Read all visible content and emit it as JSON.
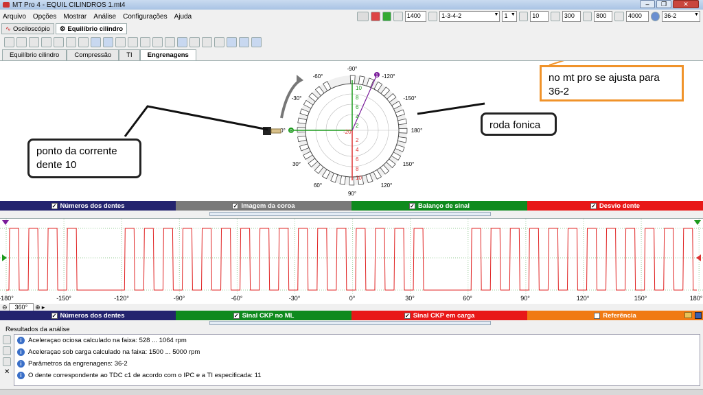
{
  "window": {
    "title": "MT Pro 4 - EQUIL CILINDROS 1.mt4"
  },
  "menu": [
    "Arquivo",
    "Opções",
    "Mostrar",
    "Análise",
    "Configurações",
    "Ajuda"
  ],
  "right_toolbar": {
    "rpm_value": "1400",
    "firing_order": "1-3-4-2",
    "cylinder": "1",
    "angle": "10",
    "field_300": "300",
    "field_800": "800",
    "field_4000": "4000",
    "wheel_type": "36-2"
  },
  "top_tabs": [
    "Osciloscópio",
    "Equilíbrio cilindro"
  ],
  "sub_tabs": [
    "Equilíbrio cilindro",
    "Compressão",
    "TI",
    "Engrenagens"
  ],
  "gear": {
    "degree_labels_top": [
      "-90°",
      "-60°",
      "-120°",
      "-30°",
      "-150°",
      "0°",
      "180°",
      "30°",
      "150°",
      "60°",
      "120°",
      "90°"
    ],
    "scale_labels": [
      "10",
      "8",
      "6",
      "4",
      "2",
      "-20",
      "2",
      "4",
      "6",
      "8",
      "10"
    ],
    "marker_zero": "0",
    "marker_one": "1"
  },
  "callouts": {
    "mt_pro": "no mt pro se ajusta para 36-2",
    "roda": "roda fonica",
    "ponto": "ponto da corrente dente 10"
  },
  "status_bar_1": [
    {
      "label": "Números dos dentes",
      "color": "#23236e"
    },
    {
      "label": "Imagem da coroa",
      "color": "#7a7a7a"
    },
    {
      "label": "Balanço de sinal",
      "color": "#0f8a1e"
    },
    {
      "label": "Desvio dente",
      "color": "#e81818"
    }
  ],
  "wave_axis": [
    "-180°",
    "-150°",
    "-120°",
    "-90°",
    "-60°",
    "-30°",
    "0°",
    "30°",
    "60°",
    "90°",
    "120°",
    "150°",
    "180°"
  ],
  "zoom": {
    "label": "360°"
  },
  "status_bar_2": [
    {
      "label": "Números dos dentes",
      "color": "#23236e"
    },
    {
      "label": "Sinal CKP no ML",
      "color": "#0f8a1e"
    },
    {
      "label": "Sinal CKP em carga",
      "color": "#e81818"
    },
    {
      "label": "Referência",
      "color": "#f07a14"
    }
  ],
  "results": {
    "header": "Resultados da análise",
    "lines": [
      "Aceleraçao ociosa calculado na faixa: 528 ... 1064 rpm",
      "Aceleraçao sob carga calculado na faixa: 1500 ... 5000 rpm",
      "Parâmetros da engrenagens: 36-2",
      "O dente correspondente ao TDC c1 de acordo com o IPC e a TI especificada: 11"
    ]
  }
}
